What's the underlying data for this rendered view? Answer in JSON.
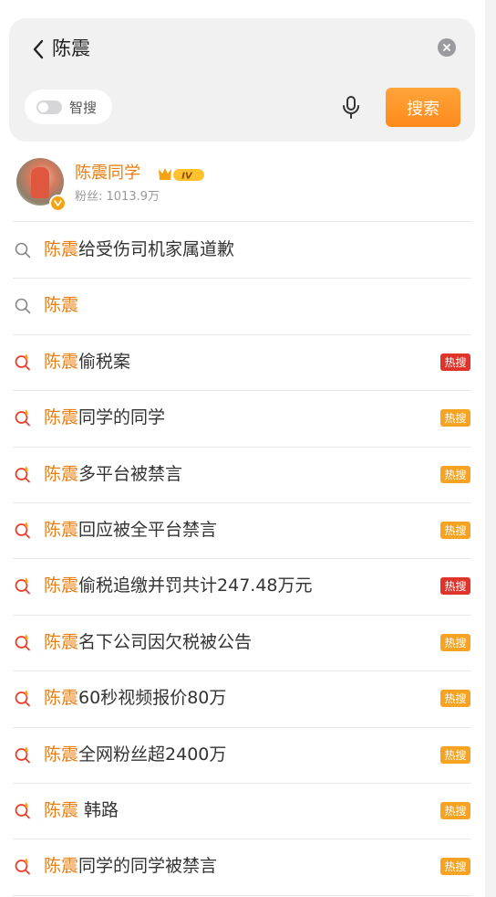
{
  "search": {
    "query": "陈震",
    "smart_label": "智搜",
    "smart_enabled": false,
    "search_button": "搜索"
  },
  "user": {
    "name": "陈震同学",
    "level": "IV",
    "fans": "粉丝: 1013.9万"
  },
  "colors": {
    "accent": "#eb7d10",
    "search_button": "#ff9a2e",
    "badge_hot": "#f5a320",
    "badge_boom": "#e0342b"
  },
  "suggestions": [
    {
      "highlight": "陈震",
      "rest": "给受伤司机家属道歉",
      "badge": "",
      "icon": "search-icon"
    },
    {
      "highlight": "陈震",
      "rest": "",
      "badge": "",
      "icon": "search-icon"
    },
    {
      "highlight": "陈震",
      "rest": "偷税案",
      "badge": "热搜",
      "badge_type": "boom",
      "icon": "hot-search-icon"
    },
    {
      "highlight": "陈震",
      "rest": "同学的同学",
      "badge": "热搜",
      "badge_type": "hot",
      "icon": "hot-search-icon"
    },
    {
      "highlight": "陈震",
      "rest": "多平台被禁言",
      "badge": "热搜",
      "badge_type": "hot",
      "icon": "hot-search-icon"
    },
    {
      "highlight": "陈震",
      "rest": "回应被全平台禁言",
      "badge": "热搜",
      "badge_type": "hot",
      "icon": "hot-search-icon"
    },
    {
      "highlight": "陈震",
      "rest": "偷税追缴并罚共计247.48万元",
      "badge": "热搜",
      "badge_type": "boom",
      "icon": "hot-search-icon"
    },
    {
      "highlight": "陈震",
      "rest": "名下公司因欠税被公告",
      "badge": "热搜",
      "badge_type": "hot",
      "icon": "hot-search-icon"
    },
    {
      "highlight": "陈震",
      "rest": "60秒视频报价80万",
      "badge": "热搜",
      "badge_type": "hot",
      "icon": "hot-search-icon"
    },
    {
      "highlight": "陈震",
      "rest": "全网粉丝超2400万",
      "badge": "热搜",
      "badge_type": "hot",
      "icon": "hot-search-icon"
    },
    {
      "highlight": "陈震",
      "rest": " 韩路",
      "badge": "热搜",
      "badge_type": "hot",
      "icon": "hot-search-icon"
    },
    {
      "highlight": "陈震",
      "rest": "同学的同学被禁言",
      "badge": "热搜",
      "badge_type": "hot",
      "icon": "hot-search-icon"
    }
  ]
}
